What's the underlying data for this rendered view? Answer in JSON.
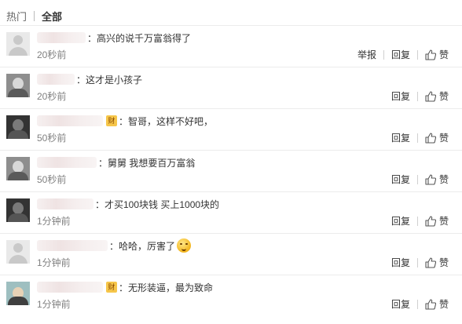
{
  "tabs": {
    "hot": "热门",
    "all": "全部"
  },
  "actions": {
    "report": "举报",
    "reply": "回复",
    "like": "赞"
  },
  "comments": [
    {
      "text": "：高兴的说千万富翁得了",
      "time": "20秒前",
      "badge": "",
      "avatar_icon": "default-avatar",
      "show_report": true,
      "suffix": ""
    },
    {
      "text": "：这才是小孩子",
      "time": "20秒前",
      "badge": "",
      "avatar_icon": "photo-avatar",
      "show_report": false,
      "suffix": ""
    },
    {
      "text": "：智哥，这样不好吧，",
      "time": "50秒前",
      "badge": "财",
      "avatar_icon": "photo-avatar",
      "show_report": false,
      "suffix": ""
    },
    {
      "text": "：舅舅 我想要百万富翁",
      "time": "50秒前",
      "badge": "",
      "avatar_icon": "photo-avatar",
      "show_report": false,
      "suffix": ""
    },
    {
      "text": "：才买100块钱 买上1000块的",
      "time": "1分钟前",
      "badge": "",
      "avatar_icon": "photo-avatar",
      "show_report": false,
      "suffix": ""
    },
    {
      "text": "：哈哈，厉害了",
      "time": "1分钟前",
      "badge": "",
      "avatar_icon": "default-avatar",
      "show_report": false,
      "suffix": "emoji"
    },
    {
      "text": "：无形装逼，最为致命",
      "time": "1分钟前",
      "badge": "财",
      "avatar_icon": "photo-avatar",
      "show_report": false,
      "suffix": ""
    }
  ],
  "colors": {
    "timestamp": "#808080",
    "divider": "#ececec",
    "badge": "#f6c64a"
  }
}
